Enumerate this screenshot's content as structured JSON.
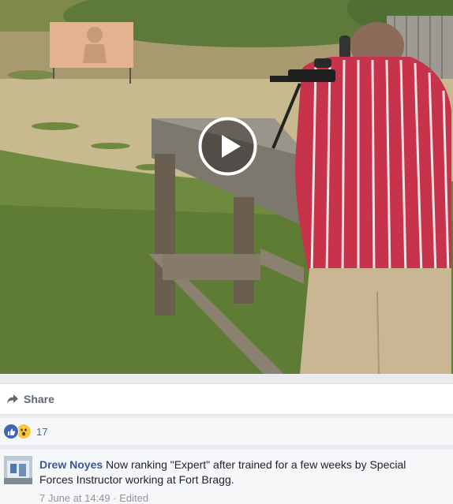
{
  "video": {
    "play_label": "Play video"
  },
  "actions": {
    "share_label": "Share"
  },
  "reactions": {
    "count": "17",
    "types": [
      "like",
      "wow"
    ]
  },
  "comment": {
    "author": "Drew Noyes",
    "text": "Now ranking \"Expert\" after trained for a few weeks by Special Forces Instructor working at Fort Bragg.",
    "timestamp": "7 June at 14:49",
    "separator": "·",
    "edited": "Edited"
  },
  "colors": {
    "link": "#385898",
    "like_blue": "#4267b2",
    "wow_yellow": "#f7c940",
    "meta_gray": "#90949c"
  }
}
